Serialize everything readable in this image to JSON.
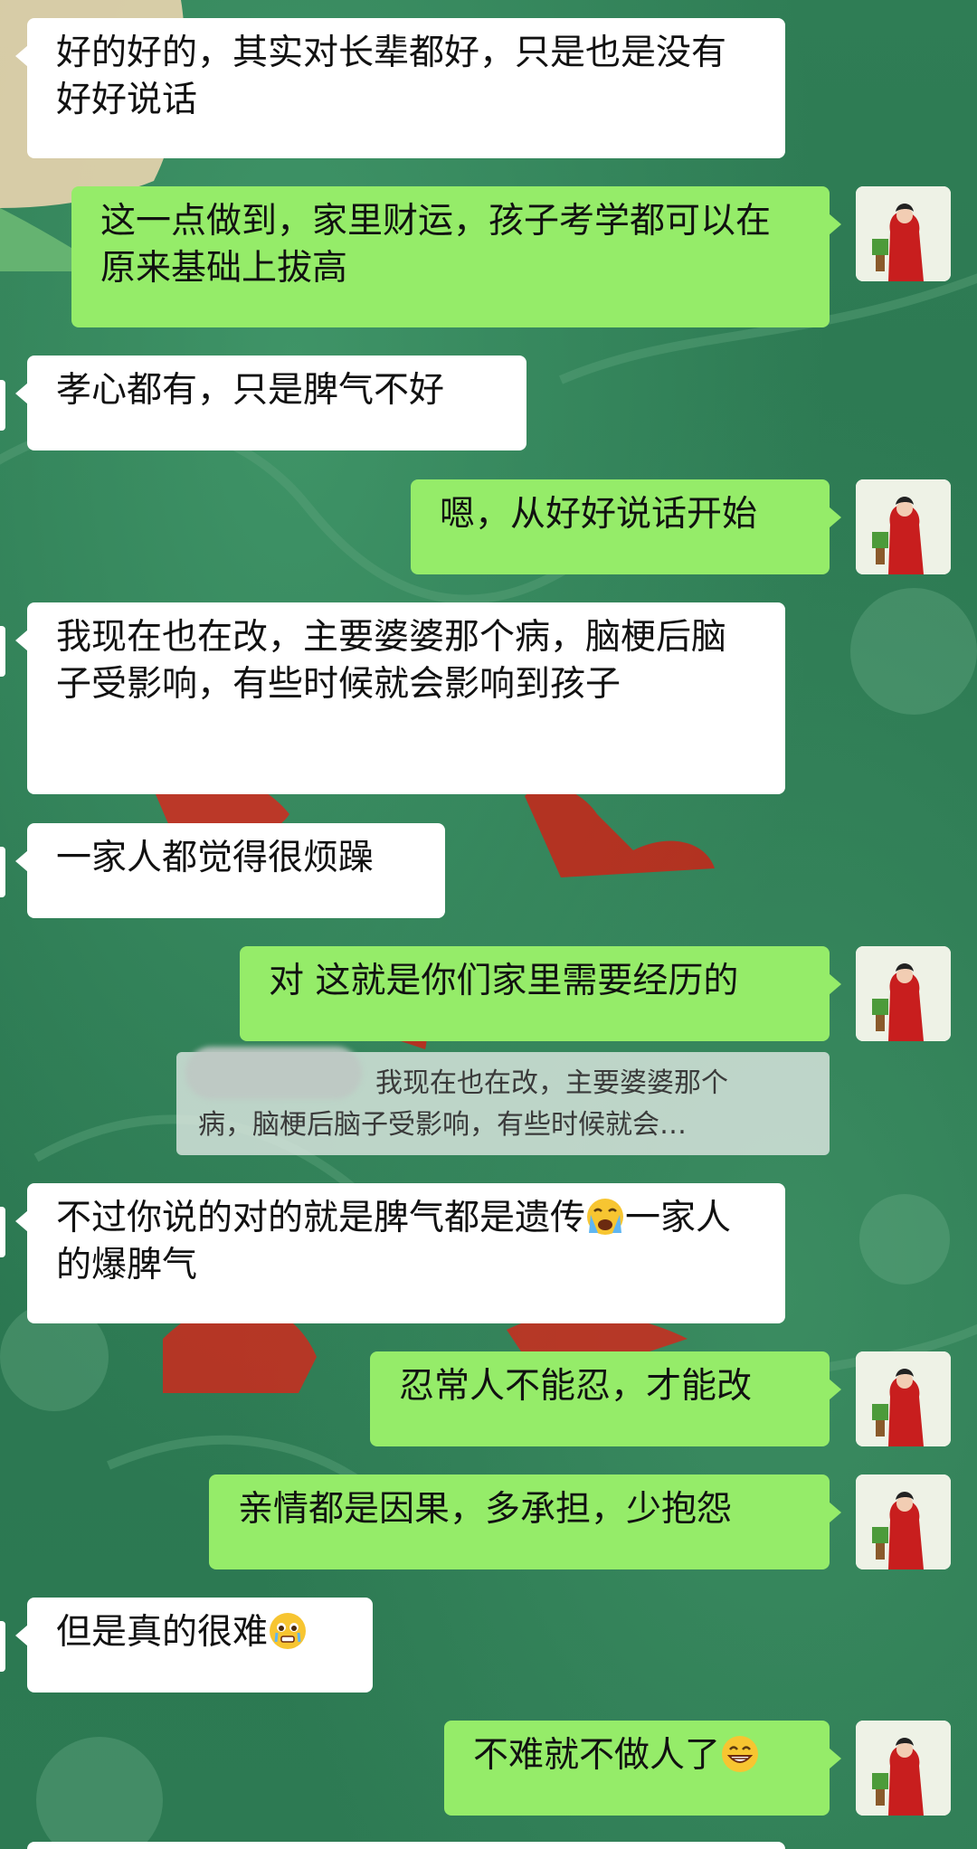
{
  "messages": [
    {
      "side": "left",
      "text": "好的好的，其实对长辈都好，只是也是没有好好说话"
    },
    {
      "side": "right",
      "text": "这一点做到，家里财运，孩子考学都可以在原来基础上拔高"
    },
    {
      "side": "left",
      "text": "孝心都有，只是脾气不好"
    },
    {
      "side": "right",
      "text": "嗯，从好好说话开始"
    },
    {
      "side": "left",
      "text": "我现在也在改，主要婆婆那个病，脑梗后脑子受影响，有些时候就会影响到孩子"
    },
    {
      "side": "left",
      "text": "一家人都觉得很烦躁"
    },
    {
      "side": "right",
      "text": "对 这就是你们家里需要经历的"
    },
    {
      "side": "left",
      "text_a": "不过你说的对的就是脾气都是遗传",
      "emoji": "crying-face-emoji",
      "text_b": "一家人的爆脾气"
    },
    {
      "side": "right",
      "text": "忍常人不能忍，才能改"
    },
    {
      "side": "right",
      "text": "亲情都是因果，多承担，少抱怨"
    },
    {
      "side": "left",
      "text": "但是真的很难",
      "emoji": "teary-face-emoji"
    },
    {
      "side": "right",
      "text": "不难就不做人了",
      "emoji": "grinning-face-emoji"
    }
  ],
  "quote": {
    "line1": "我现在也在改，主要婆婆那个",
    "line2": "病，脑梗后脑子受影响，有些时候就会…"
  },
  "colors": {
    "background": "#2e7a52",
    "outgoing_bubble": "#95ec69",
    "incoming_bubble": "#ffffff"
  },
  "icons": [
    "user-avatar",
    "crying-face-emoji",
    "teary-face-emoji",
    "grinning-face-emoji"
  ]
}
